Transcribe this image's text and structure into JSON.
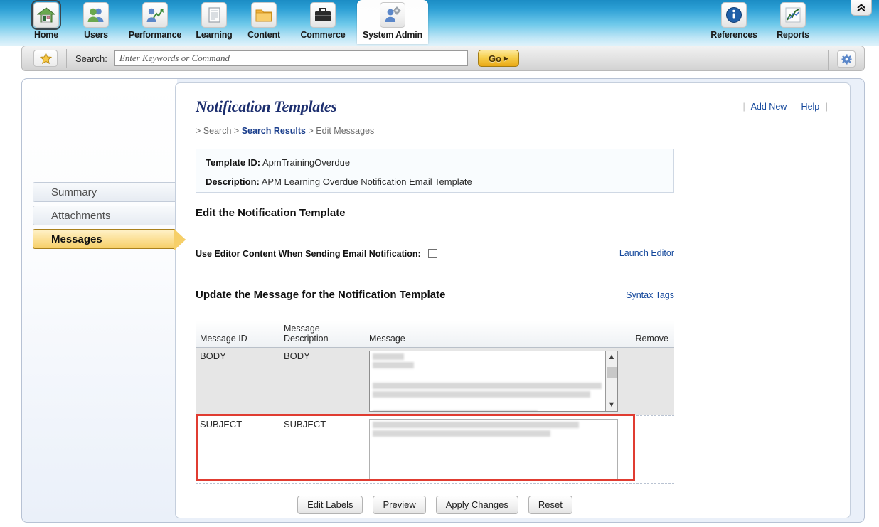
{
  "topnav": {
    "items": [
      {
        "label": "Home",
        "icon": "house-icon",
        "selected": false,
        "focused": true
      },
      {
        "label": "Users",
        "icon": "users-icon",
        "selected": false,
        "focused": false
      },
      {
        "label": "Performance",
        "icon": "chart-person-icon",
        "selected": false,
        "focused": false
      },
      {
        "label": "Learning",
        "icon": "document-icon",
        "selected": false,
        "focused": false
      },
      {
        "label": "Content",
        "icon": "folder-icon",
        "selected": false,
        "focused": false
      },
      {
        "label": "Commerce",
        "icon": "briefcase-icon",
        "selected": false,
        "focused": false
      },
      {
        "label": "System Admin",
        "icon": "person-gear-icon",
        "selected": true,
        "focused": false
      }
    ],
    "right_items": [
      {
        "label": "References",
        "icon": "info-icon"
      },
      {
        "label": "Reports",
        "icon": "line-chart-icon"
      }
    ],
    "collapse_glyph": "⌃⌃",
    "collapse_name": "collapse-header-button"
  },
  "searchbar": {
    "favorites_icon": "star-icon",
    "label": "Search:",
    "placeholder": "Enter Keywords or Command",
    "value": "",
    "go_label": "Go",
    "go_arrow": "▸",
    "settings_icon": "gear-icon"
  },
  "sidebar": {
    "items": [
      {
        "label": "Summary",
        "active": false
      },
      {
        "label": "Attachments",
        "active": false
      },
      {
        "label": "Messages",
        "active": true
      }
    ]
  },
  "page": {
    "title": "Notification Templates",
    "links": [
      {
        "label": "Add New"
      },
      {
        "label": "Help"
      }
    ],
    "breadcrumb": [
      {
        "label": "Search",
        "active": false
      },
      {
        "label": "Search Results",
        "active": true
      },
      {
        "label": "Edit Messages",
        "active": false
      }
    ],
    "breadcrumb_prefix": ">",
    "breadcrumb_sep": ">"
  },
  "info": {
    "template_id_label": "Template ID:",
    "template_id_value": "ApmTrainingOverdue",
    "description_label": "Description:",
    "description_value": "APM Learning Overdue Notification Email Template"
  },
  "edit_section": {
    "heading": "Edit the Notification Template",
    "checkbox_label": "Use Editor Content When Sending Email Notification:",
    "checkbox_checked": false,
    "launch_editor_link": "Launch Editor"
  },
  "message_section": {
    "heading": "Update the Message for the Notification Template",
    "syntax_tags_link": "Syntax Tags",
    "columns": [
      "Message ID",
      "Message Description",
      "Message",
      "Remove"
    ],
    "column_message_description_line1": "Message",
    "column_message_description_line2": "Description",
    "rows": [
      {
        "message_id": "BODY",
        "description": "BODY",
        "message": "",
        "redacted": true,
        "has_scrollbar": true,
        "highlighted": false
      },
      {
        "message_id": "SUBJECT",
        "description": "SUBJECT",
        "message": "",
        "redacted": true,
        "has_scrollbar": false,
        "highlighted": true
      }
    ]
  },
  "buttons": [
    {
      "label": "Edit Labels"
    },
    {
      "label": "Preview"
    },
    {
      "label": "Apply Changes"
    },
    {
      "label": "Reset"
    }
  ],
  "colors": {
    "accent_blue": "#14489c",
    "header_blue_top": "#1b8cc4",
    "header_blue_bottom": "#e2f3fb",
    "active_tab_gold": "#f6cf68",
    "highlight_red": "#e03c31",
    "go_button_gold": "#e9a815"
  }
}
